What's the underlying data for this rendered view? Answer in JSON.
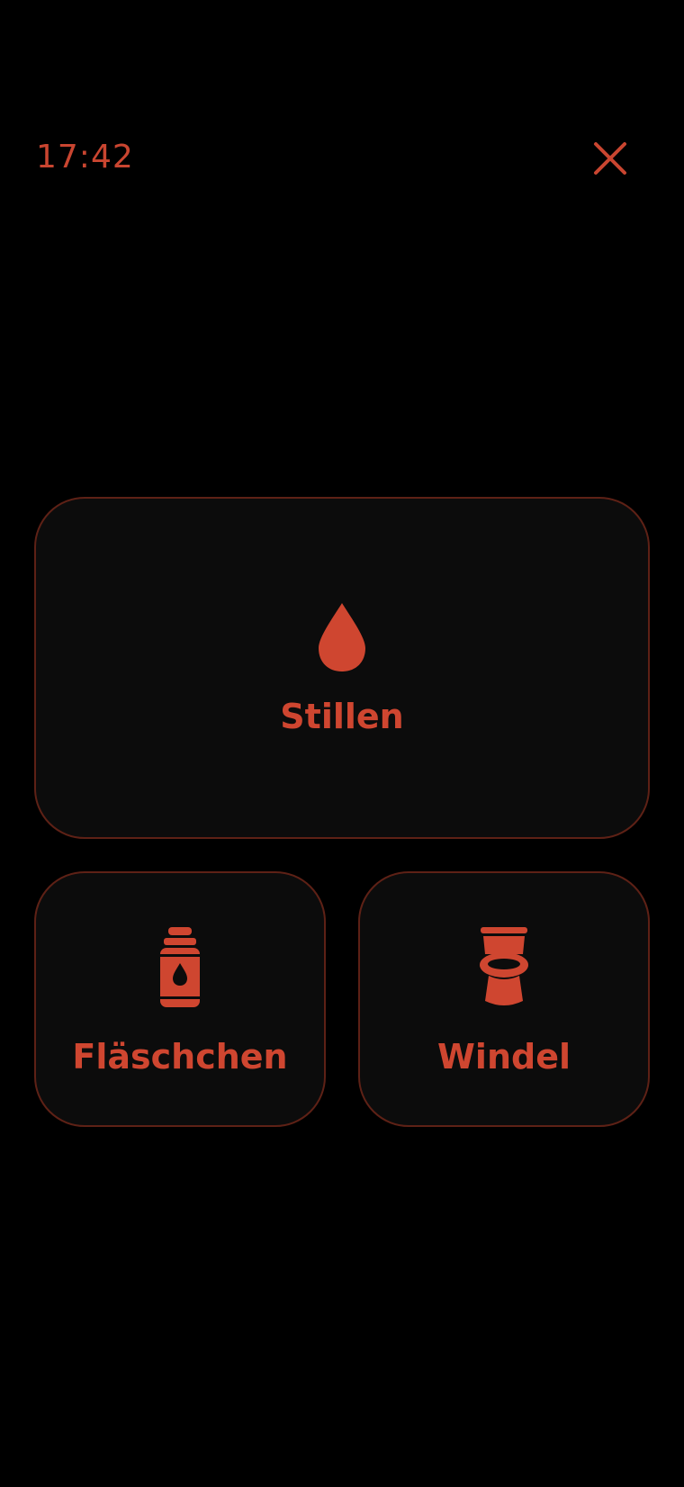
{
  "header": {
    "time": "17:42",
    "close_icon": "close-icon"
  },
  "actions": [
    {
      "label": "Stillen",
      "icon": "drop-icon"
    },
    {
      "label": "Fläschchen",
      "icon": "bottle-icon"
    },
    {
      "label": "Windel",
      "icon": "toilet-icon"
    }
  ],
  "colors": {
    "background": "#000000",
    "accent": "#cf4630",
    "card_background": "#0c0c0c",
    "card_border": "#5e2116"
  }
}
